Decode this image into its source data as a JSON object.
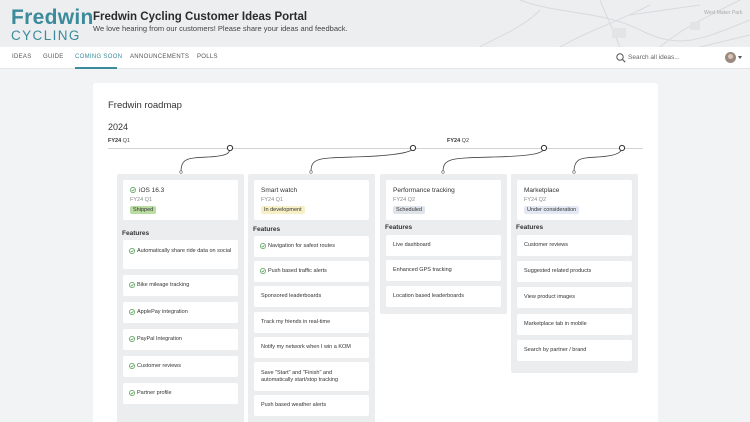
{
  "header": {
    "logo_top": "Fredwin",
    "logo_bottom": "CYCLING",
    "title": "Fredwin Cycling Customer Ideas Portal",
    "subtitle": "We love hearing from our customers! Please share your ideas and feedback.",
    "map_label": "West Maker Park"
  },
  "nav": {
    "items": [
      "IDEAS",
      "GUIDE",
      "COMING SOON",
      "ANNOUNCEMENTS",
      "POLLS"
    ],
    "active": "COMING SOON",
    "search_placeholder": "Search all ideas..."
  },
  "roadmap": {
    "title": "Fredwin roadmap",
    "year": "2024",
    "quarter_labels": [
      {
        "bold": "FY24",
        "rest": " Q1"
      },
      {
        "bold": "FY24",
        "rest": " Q2"
      }
    ],
    "features_heading": "Features",
    "columns": [
      {
        "name": "iOS 16.3",
        "shipped_check": true,
        "quarter": "FY24 Q1",
        "status": "Shipped",
        "status_color": "#b9dca1",
        "features": [
          {
            "text": "Automatically share ride data on social",
            "check": true
          },
          {
            "text": "Bike mileage tracking",
            "check": true
          },
          {
            "text": "ApplePay integration",
            "check": true
          },
          {
            "text": "PayPal Integration",
            "check": true
          },
          {
            "text": "Customer reviews",
            "check": true
          },
          {
            "text": "Partner profile",
            "check": true
          }
        ]
      },
      {
        "name": "Smart watch",
        "shipped_check": false,
        "quarter": "FY24 Q1",
        "status": "In development",
        "status_color": "#f7f0c6",
        "features": [
          {
            "text": "Navigation for safest routes",
            "check": true
          },
          {
            "text": "Push based traffic alerts",
            "check": true
          },
          {
            "text": "Sponsored leaderboards",
            "check": false
          },
          {
            "text": "Track my friends in real-time",
            "check": false
          },
          {
            "text": "Notify my network when I win a KOM",
            "check": false
          },
          {
            "text": "Save \"Start\" and \"Finish\" and automatically start/stop tracking",
            "check": false
          },
          {
            "text": "Push based weather alerts",
            "check": false
          }
        ]
      },
      {
        "name": "Performance tracking",
        "shipped_check": false,
        "quarter": "FY24 Q2",
        "status": "Scheduled",
        "status_color": "#dfe3ea",
        "features": [
          {
            "text": "Live dashboard",
            "check": false
          },
          {
            "text": "Enhanced GPS tracking",
            "check": false
          },
          {
            "text": "Location based leaderboards",
            "check": false
          }
        ]
      },
      {
        "name": "Marketplace",
        "shipped_check": false,
        "quarter": "FY24 Q2",
        "status": "Under consideration",
        "status_color": "#e3e8f4",
        "features": [
          {
            "text": "Customer reviews",
            "check": false
          },
          {
            "text": "Suggested related products",
            "check": false
          },
          {
            "text": "View product images",
            "check": false
          },
          {
            "text": "Marketplace tab in mobile",
            "check": false
          },
          {
            "text": "Search by partner / brand",
            "check": false
          }
        ]
      }
    ]
  },
  "colors": {
    "accent": "#3b8b9b",
    "check_green": "#4a9a4a"
  }
}
